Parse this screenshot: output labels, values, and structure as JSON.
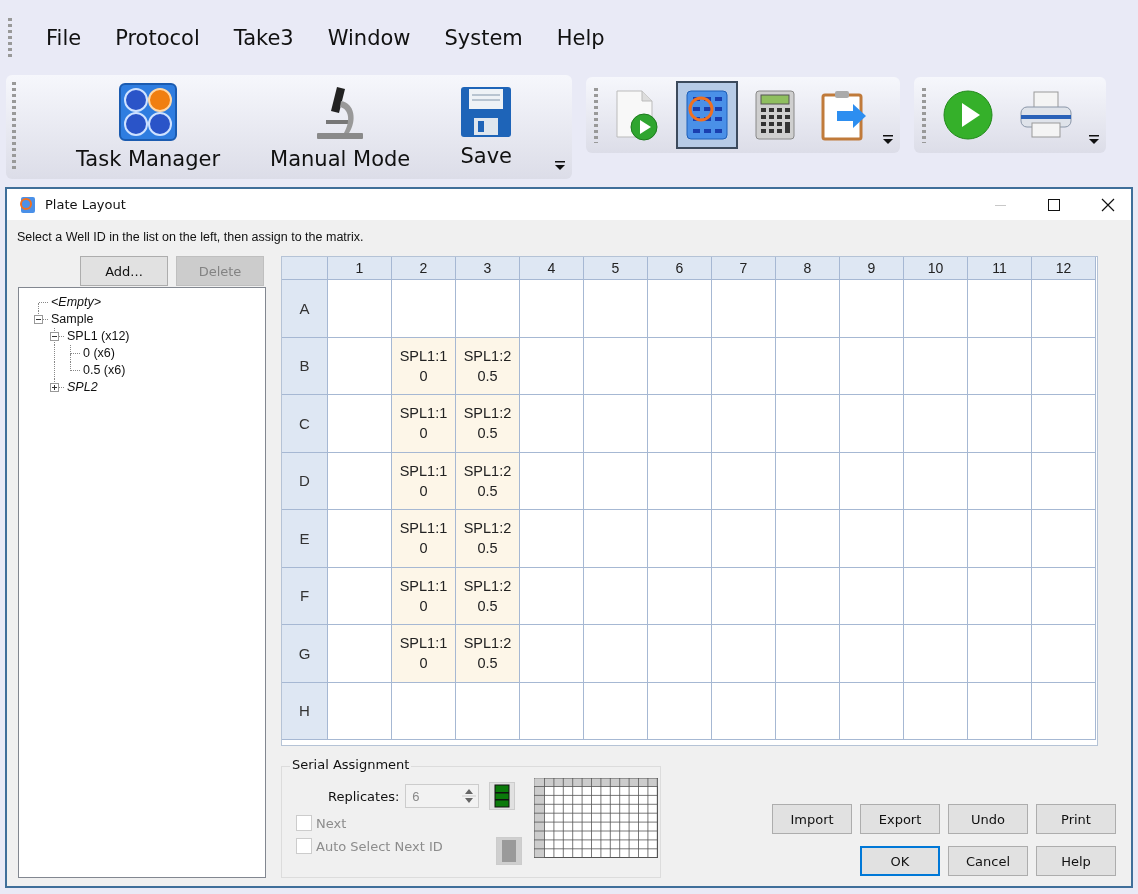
{
  "menu": [
    "File",
    "Protocol",
    "Take3",
    "Window",
    "System",
    "Help"
  ],
  "toolbar": {
    "buttons": [
      {
        "label": "Task Manager"
      },
      {
        "label": "Manual Mode"
      },
      {
        "label": "Save"
      }
    ]
  },
  "quick_toolbars": [
    {
      "buttons": [
        {
          "selected": false
        },
        {
          "selected": true
        },
        {
          "selected": false
        },
        {
          "selected": false
        }
      ]
    },
    {
      "buttons": [
        {
          "selected": false
        },
        {
          "selected": false
        }
      ]
    }
  ],
  "dialog": {
    "title": "Plate Layout",
    "instruction": "Select a Well ID in the list on the left, then assign to the matrix.",
    "id_buttons": [
      {
        "label": "Add...",
        "disabled": false
      },
      {
        "label": "Delete",
        "disabled": true
      }
    ],
    "tree": [
      {
        "label": "<Empty>",
        "italic": true
      },
      {
        "label": "Sample",
        "italic": false,
        "expanded": true,
        "children": [
          {
            "label": "SPL1 (x12)",
            "italic": false,
            "expanded": true,
            "children": [
              {
                "label": "0 (x6)",
                "italic": false
              },
              {
                "label": "0.5 (x6)",
                "italic": false
              }
            ]
          },
          {
            "label": "SPL2",
            "italic": true,
            "expanded": false
          }
        ]
      }
    ],
    "plate": {
      "columns": [
        "1",
        "2",
        "3",
        "4",
        "5",
        "6",
        "7",
        "8",
        "9",
        "10",
        "11",
        "12"
      ],
      "rows": [
        {
          "label": "A",
          "wells": [
            {
              "assigned": false
            },
            {
              "assigned": false
            },
            {
              "assigned": false
            },
            {
              "assigned": false
            },
            {
              "assigned": false
            },
            {
              "assigned": false
            },
            {
              "assigned": false
            },
            {
              "assigned": false
            },
            {
              "assigned": false
            },
            {
              "assigned": false
            },
            {
              "assigned": false
            },
            {
              "assigned": false
            }
          ]
        },
        {
          "label": "B",
          "wells": [
            {
              "assigned": false
            },
            {
              "assigned": true,
              "id": "SPL1:1",
              "value": "0"
            },
            {
              "assigned": true,
              "id": "SPL1:2",
              "value": "0.5"
            },
            {
              "assigned": false
            },
            {
              "assigned": false
            },
            {
              "assigned": false
            },
            {
              "assigned": false
            },
            {
              "assigned": false
            },
            {
              "assigned": false
            },
            {
              "assigned": false
            },
            {
              "assigned": false
            },
            {
              "assigned": false
            }
          ]
        },
        {
          "label": "C",
          "wells": [
            {
              "assigned": false
            },
            {
              "assigned": true,
              "id": "SPL1:1",
              "value": "0"
            },
            {
              "assigned": true,
              "id": "SPL1:2",
              "value": "0.5"
            },
            {
              "assigned": false
            },
            {
              "assigned": false
            },
            {
              "assigned": false
            },
            {
              "assigned": false
            },
            {
              "assigned": false
            },
            {
              "assigned": false
            },
            {
              "assigned": false
            },
            {
              "assigned": false
            },
            {
              "assigned": false
            }
          ]
        },
        {
          "label": "D",
          "wells": [
            {
              "assigned": false
            },
            {
              "assigned": true,
              "id": "SPL1:1",
              "value": "0"
            },
            {
              "assigned": true,
              "id": "SPL1:2",
              "value": "0.5"
            },
            {
              "assigned": false
            },
            {
              "assigned": false
            },
            {
              "assigned": false
            },
            {
              "assigned": false
            },
            {
              "assigned": false
            },
            {
              "assigned": false
            },
            {
              "assigned": false
            },
            {
              "assigned": false
            },
            {
              "assigned": false
            }
          ]
        },
        {
          "label": "E",
          "wells": [
            {
              "assigned": false
            },
            {
              "assigned": true,
              "id": "SPL1:1",
              "value": "0"
            },
            {
              "assigned": true,
              "id": "SPL1:2",
              "value": "0.5"
            },
            {
              "assigned": false
            },
            {
              "assigned": false
            },
            {
              "assigned": false
            },
            {
              "assigned": false
            },
            {
              "assigned": false
            },
            {
              "assigned": false
            },
            {
              "assigned": false
            },
            {
              "assigned": false
            },
            {
              "assigned": false
            }
          ]
        },
        {
          "label": "F",
          "wells": [
            {
              "assigned": false
            },
            {
              "assigned": true,
              "id": "SPL1:1",
              "value": "0"
            },
            {
              "assigned": true,
              "id": "SPL1:2",
              "value": "0.5"
            },
            {
              "assigned": false
            },
            {
              "assigned": false
            },
            {
              "assigned": false
            },
            {
              "assigned": false
            },
            {
              "assigned": false
            },
            {
              "assigned": false
            },
            {
              "assigned": false
            },
            {
              "assigned": false
            },
            {
              "assigned": false
            }
          ]
        },
        {
          "label": "G",
          "wells": [
            {
              "assigned": false
            },
            {
              "assigned": true,
              "id": "SPL1:1",
              "value": "0"
            },
            {
              "assigned": true,
              "id": "SPL1:2",
              "value": "0.5"
            },
            {
              "assigned": false
            },
            {
              "assigned": false
            },
            {
              "assigned": false
            },
            {
              "assigned": false
            },
            {
              "assigned": false
            },
            {
              "assigned": false
            },
            {
              "assigned": false
            },
            {
              "assigned": false
            },
            {
              "assigned": false
            }
          ]
        },
        {
          "label": "H",
          "wells": [
            {
              "assigned": false
            },
            {
              "assigned": false
            },
            {
              "assigned": false
            },
            {
              "assigned": false
            },
            {
              "assigned": false
            },
            {
              "assigned": false
            },
            {
              "assigned": false
            },
            {
              "assigned": false
            },
            {
              "assigned": false
            },
            {
              "assigned": false
            },
            {
              "assigned": false
            },
            {
              "assigned": false
            }
          ]
        }
      ]
    },
    "serial_assignment": {
      "title": "Serial Assignment",
      "replicates_label": "Replicates:",
      "replicates": {
        "value": "6",
        "disabled": true
      },
      "direction_buttons": [
        {
          "disabled": false
        },
        {
          "disabled": true
        }
      ],
      "options": [
        {
          "label": "Next",
          "checked": false,
          "disabled": true
        },
        {
          "label": "Auto Select Next ID",
          "checked": false,
          "disabled": true
        }
      ]
    },
    "actions": [
      {
        "label": "Import",
        "default": false
      },
      {
        "label": "Export",
        "default": false
      },
      {
        "label": "Undo",
        "default": false
      },
      {
        "label": "Print",
        "default": false
      },
      {
        "label": "OK",
        "default": true
      },
      {
        "label": "Cancel",
        "default": false
      },
      {
        "label": "Help",
        "default": false
      }
    ]
  }
}
